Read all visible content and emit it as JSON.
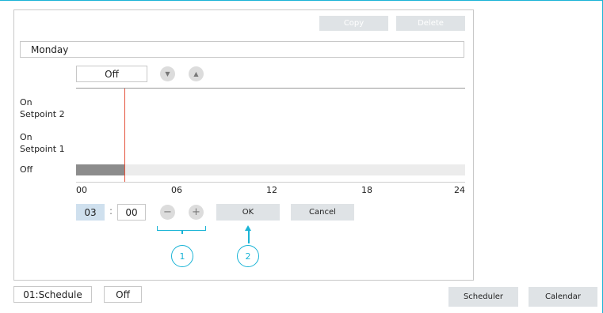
{
  "toolbar": {
    "copy_label": "Copy",
    "delete_label": "Delete"
  },
  "day": "Monday",
  "state": {
    "value": "Off",
    "down_icon": "chevron-down-icon",
    "up_icon": "chevron-up-icon"
  },
  "chart": {
    "levels": [
      "On\nSetpoint 2",
      "On\nSetpoint 1",
      "Off"
    ],
    "level_lines": {
      "sp2_a": "On",
      "sp2_b": "Setpoint 2",
      "sp1_a": "On",
      "sp1_b": "Setpoint 1",
      "off": "Off"
    },
    "x_ticks": [
      "00",
      "06",
      "12",
      "18",
      "24"
    ],
    "x_range_hours": [
      0,
      24
    ],
    "off_period_end_hours": 3,
    "cursor_hours": 3
  },
  "time": {
    "hour": "03",
    "separator": ":",
    "minute": "00"
  },
  "controls": {
    "minus_icon": "minus-icon",
    "plus_icon": "plus-icon",
    "ok_label": "OK",
    "cancel_label": "Cancel"
  },
  "callouts": {
    "one": "1",
    "two": "2"
  },
  "footer": {
    "schedule_label": "01:Schedule",
    "status": "Off",
    "scheduler_label": "Scheduler",
    "calendar_label": "Calendar"
  },
  "colors": {
    "accent": "#1ab4d6",
    "cursor": "#e5533d",
    "off_fill": "#8c8c8c"
  }
}
